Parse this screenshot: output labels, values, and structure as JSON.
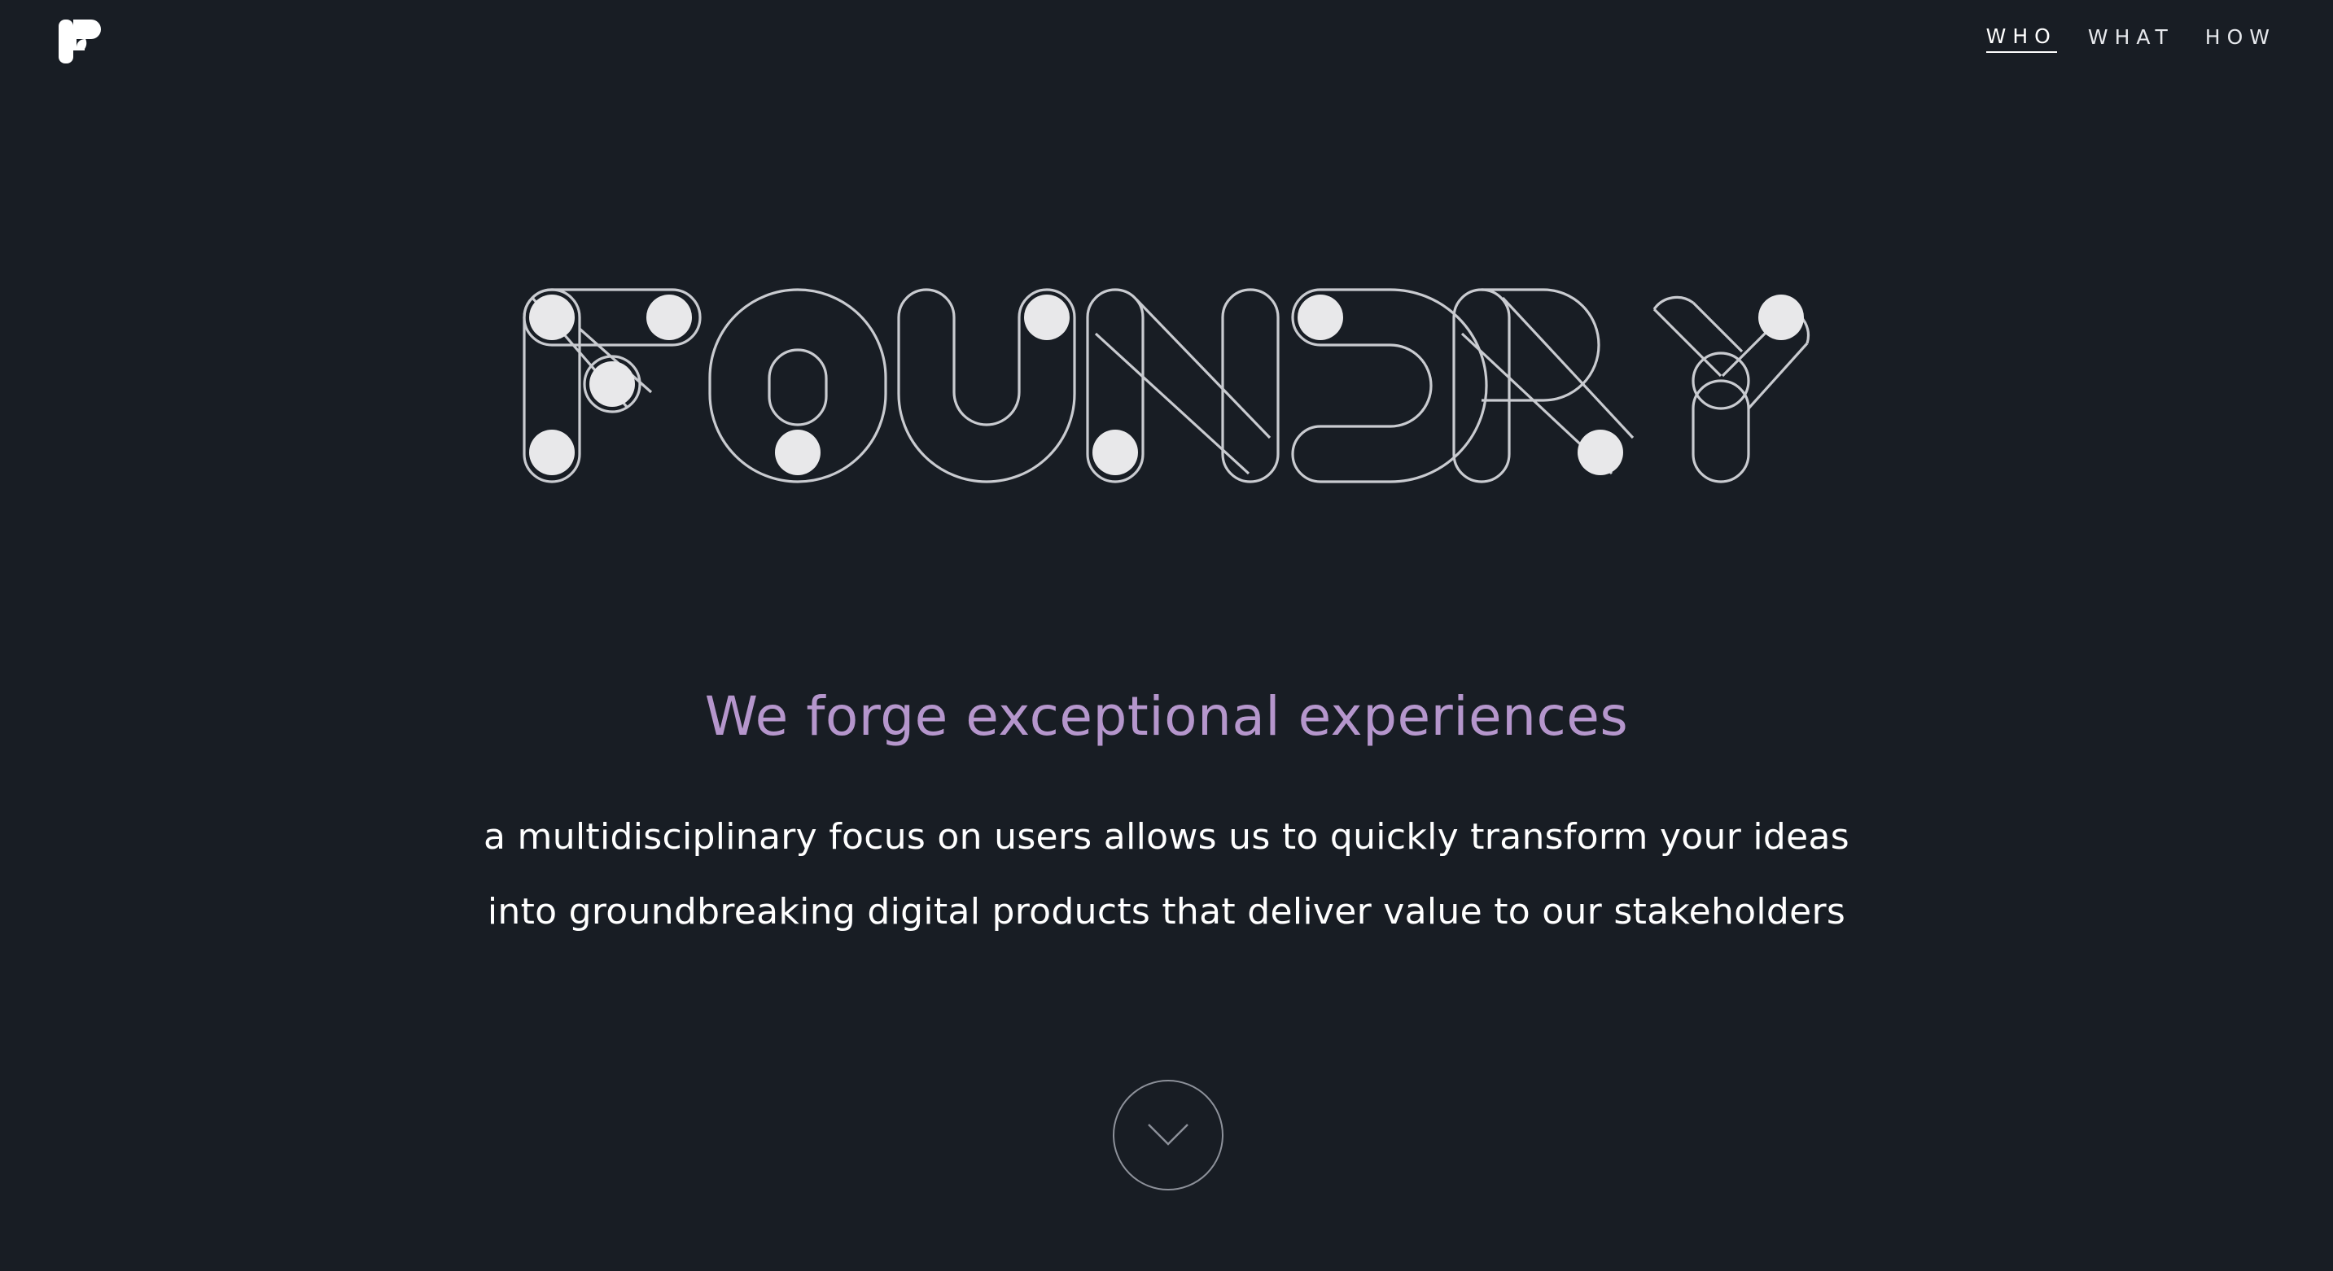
{
  "brand": {
    "logo_icon": "foundry-f-logo-icon",
    "wordmark": "FOUNDRY"
  },
  "nav": {
    "items": [
      {
        "label": "WHO",
        "active": true
      },
      {
        "label": "WHAT",
        "active": false
      },
      {
        "label": "HOW",
        "active": false
      }
    ]
  },
  "hero": {
    "tagline": "We forge exceptional experiences",
    "description_line1": "a multidisciplinary focus on users allows us to quickly transform your ideas",
    "description_line2": "into groundbreaking digital products that deliver value to our stakeholders",
    "scroll_icon": "chevron-down-icon"
  },
  "colors": {
    "background": "#181d24",
    "accent": "#b596cc",
    "text": "#ffffff"
  }
}
